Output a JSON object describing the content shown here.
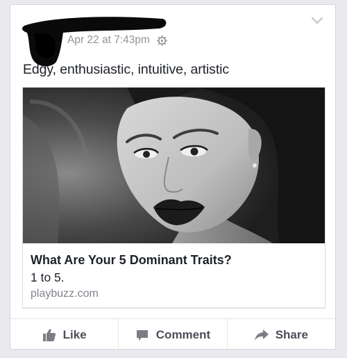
{
  "post": {
    "timestamp": "Apr 22 at 7:43pm",
    "text": "Edgy, enthusiastic, intuitive, artistic"
  },
  "link": {
    "title": "What Are Your 5 Dominant Traits?",
    "description": "1 to 5.",
    "domain": "playbuzz.com"
  },
  "actions": {
    "like": "Like",
    "comment": "Comment",
    "share": "Share"
  },
  "colors": {
    "background": "#e9eaed",
    "card": "#ffffff",
    "text": "#1d2129",
    "muted": "#8f949b",
    "action": "#4b4f56"
  }
}
